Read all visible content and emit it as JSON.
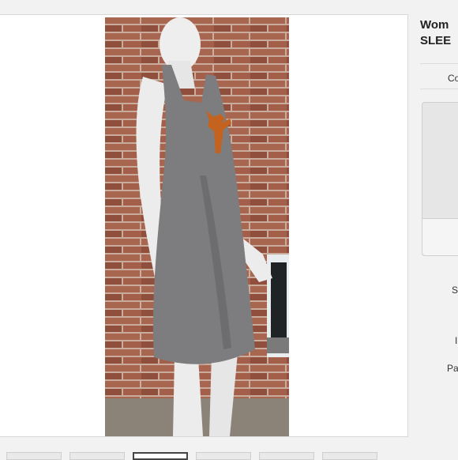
{
  "listing": {
    "title_line1": "Wom",
    "title_line2": "SLEE",
    "condition_label": "Co",
    "size_label": "S",
    "brand_label": "I",
    "pattern_label": "Pa"
  },
  "gallery": {
    "photo_alt": "Gray sleeveless dress on mannequin",
    "thumbnail_count": 6,
    "active_thumbnail": 2
  },
  "colors": {
    "dress": "#7d7d7f",
    "logo": "#c4621f",
    "brick": "#9b5a44",
    "mortar": "#c9ac9c"
  }
}
